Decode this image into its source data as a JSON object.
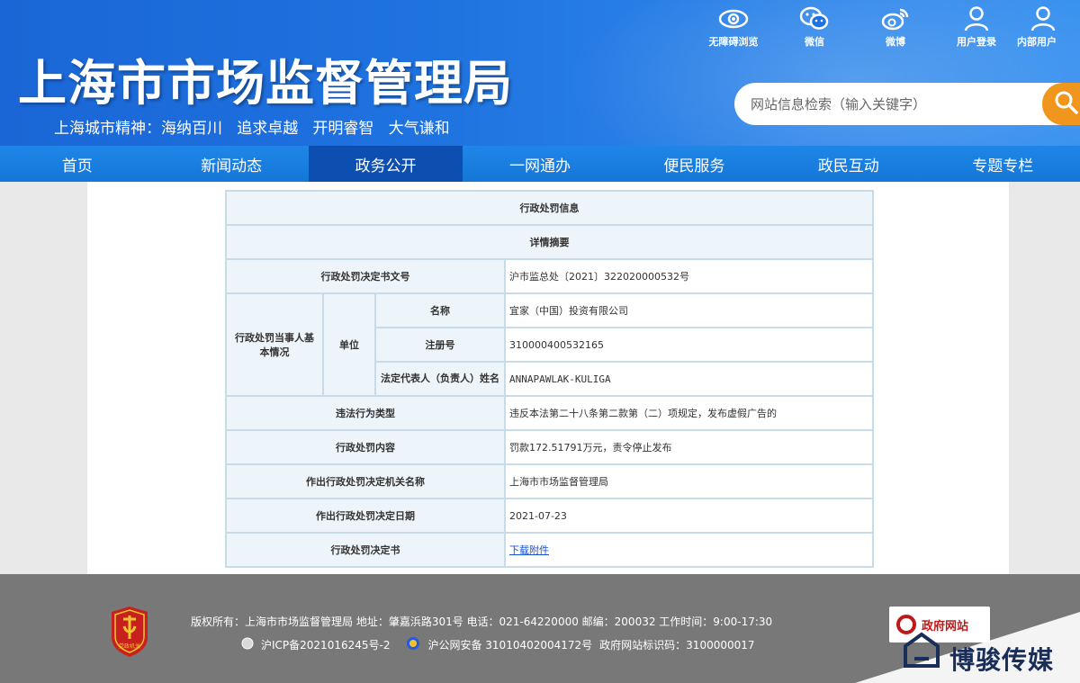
{
  "header": {
    "title": "上海市市场监督管理局",
    "slogan": "上海城市精神：海纳百川   追求卓越   开明睿智   大气谦和",
    "top_links": [
      {
        "label": "无障碍浏览",
        "icon": "eye-icon"
      },
      {
        "label": "微信",
        "icon": "wechat-icon"
      },
      {
        "label": "微博",
        "icon": "weibo-icon"
      },
      {
        "label": "用户登录",
        "icon": "user-icon"
      },
      {
        "label": "内部用户",
        "icon": "user-icon"
      }
    ],
    "search_placeholder": "网站信息检索（输入关键字）"
  },
  "nav": {
    "items": [
      "首页",
      "新闻动态",
      "政务公开",
      "一网通办",
      "便民服务",
      "政民互动",
      "专题专栏"
    ],
    "active_index": 2
  },
  "table": {
    "title": "行政处罚信息",
    "subtitle": "详情摘要",
    "doc_no_label": "行政处罚决定书文号",
    "doc_no_value": "沪市监总处〔2021〕322020000532号",
    "party_label": "行政处罚当事人基本情况",
    "unit_label": "单位",
    "name_label": "名称",
    "name_value": "宜家（中国）投资有限公司",
    "reg_label": "注册号",
    "reg_value": "310000400532165",
    "rep_label": "法定代表人（负责人）姓名",
    "rep_value": "ANNAPAWLAK-KULIGA",
    "violation_label": "违法行为类型",
    "violation_value": "违反本法第二十八条第二款第（二）项规定，发布虚假广告的",
    "content_label": "行政处罚内容",
    "content_value": "罚款172.51791万元，责令停止发布",
    "org_label": "作出行政处罚决定机关名称",
    "org_value": "上海市市场监督管理局",
    "date_label": "作出行政处罚决定日期",
    "date_value": "2021-07-23",
    "decision_label": "行政处罚决定书",
    "decision_link": "下载附件"
  },
  "footer": {
    "line1": "版权所有：上海市市场监督管理局  地址：肇嘉浜路301号  电话：021-64220000  邮编：200032  工作时间：9:00-17:30",
    "icp": "沪ICP备2021016245号-2",
    "police": "沪公网安备 31010402004172号",
    "gov_id": "政府网站标识码：3100000017",
    "badge": "政府网站",
    "emblem_text": "党政机关"
  },
  "watermark": "博骏传媒",
  "colors": {
    "header_blue": "#1f73e0",
    "nav_blue": "#1477d8",
    "nav_active": "#0d4fb0",
    "search_orange": "#f0961c",
    "footer_gray": "#787878",
    "table_border": "#c8dbe8",
    "label_bg": "#eef5fa",
    "link": "#1a4fd1"
  }
}
